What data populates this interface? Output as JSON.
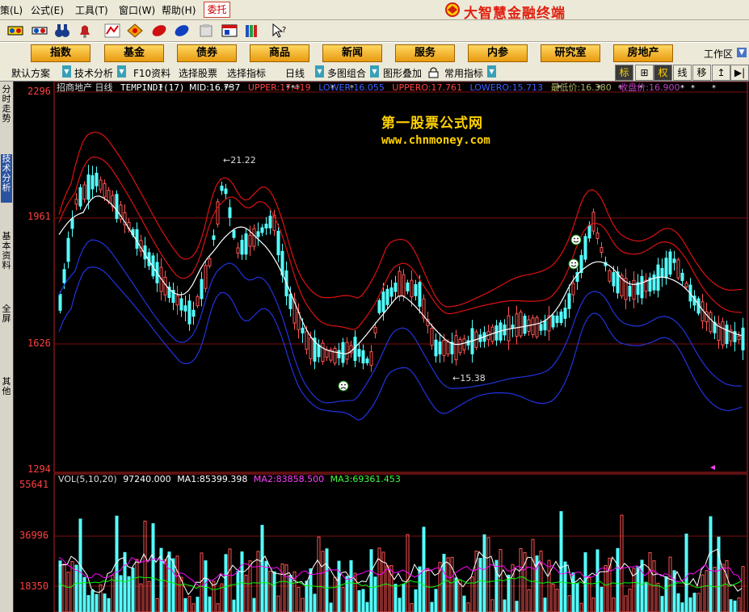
{
  "menu": {
    "items": [
      {
        "label": "策(L)"
      },
      {
        "label": "公式(E)"
      },
      {
        "label": "工具(T)"
      },
      {
        "label": "窗口(W)"
      },
      {
        "label": "帮助(H)"
      }
    ],
    "entrust": "委托",
    "brand": "大智慧金融终端"
  },
  "toolbar": {
    "icons": [
      "indicator-icon",
      "binoculars-icon",
      "alert-bell-icon",
      "stock-picker-icon",
      "diamond-icon",
      "tag-icon",
      "pen-icon",
      "document-icon",
      "window-layout-icon",
      "books-icon",
      "help-cursor-icon"
    ]
  },
  "categories": [
    "指数",
    "基金",
    "债券",
    "商品",
    "新闻",
    "服务",
    "内参",
    "研究室",
    "房地产"
  ],
  "workarea": "工作区",
  "funcbar": {
    "items": [
      "默认方案",
      "技术分析",
      "F10资料",
      "选择股票",
      "选择指标",
      "日线",
      "多图组合",
      "图形叠加",
      "常用指标"
    ],
    "buttons": [
      "标",
      "⊞",
      "权",
      "线",
      "移",
      "↥",
      "▶|"
    ]
  },
  "lefttabs": [
    "分时走势",
    "技术分析",
    "基本资料",
    "全屏",
    "其他"
  ],
  "chart": {
    "stock_title": "招商地产 日线",
    "indicator": "TEMPINDI(17)",
    "mid_label": "MID:",
    "mid_value": "16.737",
    "upper_label": "UPPER:",
    "upper_value": "17.419",
    "lower_label": "LOWER:",
    "lower_value": "16.055",
    "uppero_label": "UPPERO:",
    "uppero_value": "17.761",
    "lowero_label": "LOWERO:",
    "lowero_value": "15.713",
    "low_label": "最低价:",
    "low_value": "16.380",
    "close_label": "收盘价:",
    "close_value": "16.900",
    "y_ticks": [
      "2296",
      "1961",
      "1626",
      "1294"
    ],
    "high_annotation": "←21.22",
    "low_annotation": "←15.38",
    "watermark_title": "第一股票公式网",
    "watermark_url": "www.chnmoney.com"
  },
  "volume": {
    "label": "VOL(5,10,20)",
    "vol_value": "97240.000",
    "ma1_label": "MA1:",
    "ma1_value": "85399.398",
    "ma2_label": "MA2:",
    "ma2_value": "83858.500",
    "ma3_label": "MA3:",
    "ma3_value": "69361.453",
    "y_ticks": [
      "55641",
      "36996",
      "18350"
    ]
  },
  "colors": {
    "up": "#ff5555",
    "down": "#55ffff",
    "upper_band": "#dd1111",
    "lower_band": "#2233dd",
    "mid_line": "#ffffff",
    "ma1": "#ffffff",
    "ma2": "#ff00ff",
    "ma3": "#00ff00"
  }
}
